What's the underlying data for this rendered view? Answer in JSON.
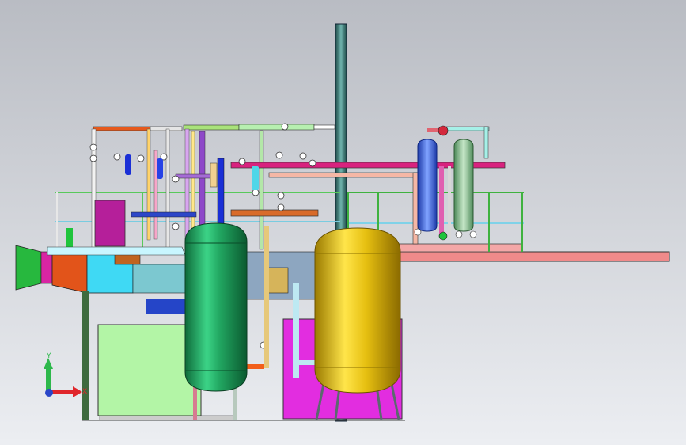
{
  "viewport": {
    "background_top": "#b9bcc3",
    "background_bottom": "#eceef2"
  },
  "triad": {
    "y_label": "Y",
    "x_label": "X",
    "y_color": "#2db84b",
    "x_color": "#e0262b",
    "z_color": "#2a46c8"
  },
  "colors": {
    "left_tank": "#1f9a55",
    "right_tank": "#e8c21a",
    "stack": "#2f6f6a",
    "platform": "#f08a8a",
    "duct_orange": "#e65a1c",
    "duct_cyan": "#4fe0f0",
    "magenta_box": "#e12be0",
    "green_box": "#a8f59a"
  }
}
